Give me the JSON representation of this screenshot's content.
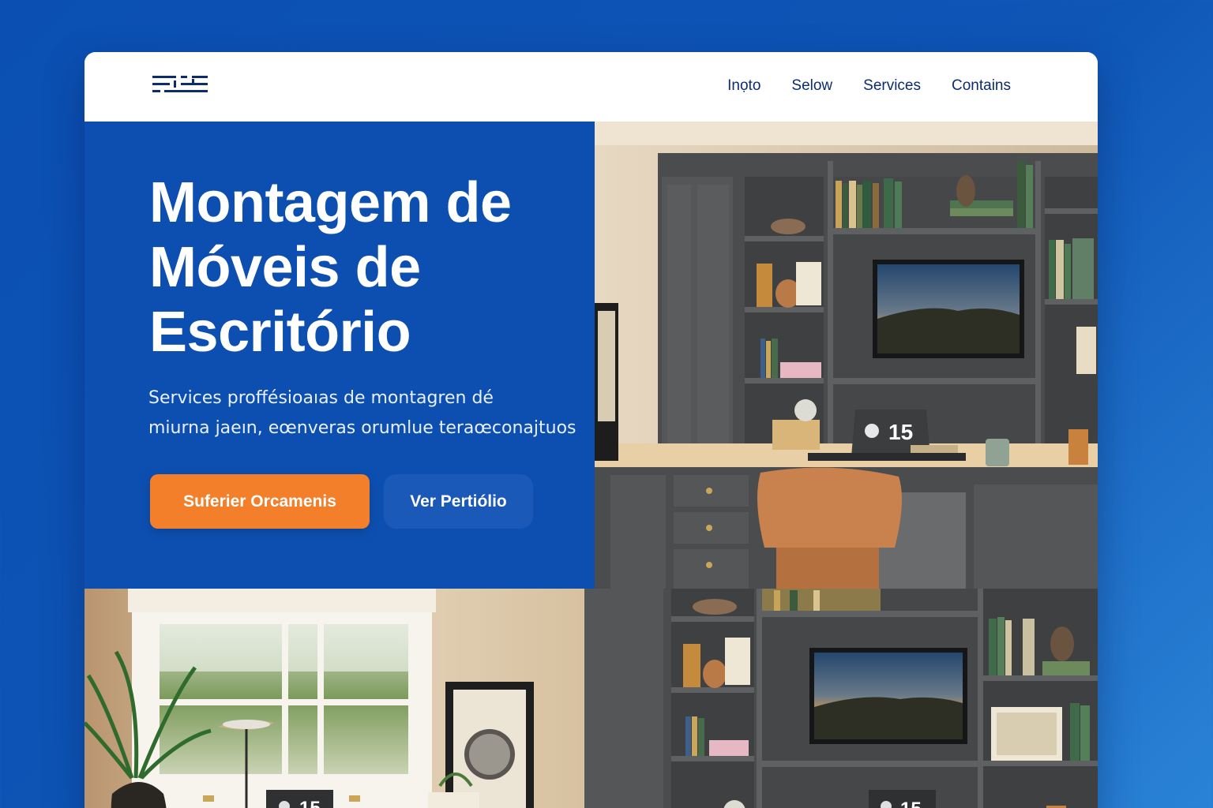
{
  "nav": {
    "logo_icon": "brand-logo-icon",
    "links": [
      "Inọto",
      "Selow",
      "Services",
      "Contains"
    ]
  },
  "hero": {
    "title_lines": [
      "Montagem de",
      "Móveis de",
      "Escritório"
    ],
    "subtitle_lines": [
      "Services proffésioaıas de montagren dé",
      "miurna jaeın, eœnveras orumlue teraœconajtuos"
    ],
    "primary_button": "Suferier Orcamenis",
    "secondary_button": "Ver Pertiólio"
  },
  "photos": {
    "laptop_badge": "15"
  },
  "colors": {
    "background": "#0e55b6",
    "hero_panel": "#0d4fb0",
    "nav_text": "#0b2c6e",
    "primary_button": "#f47f2a",
    "secondary_button": "#1a59b7",
    "cabinet": "#4a4b4c",
    "desk_top": "#e8cfa5",
    "chair": "#c9814e"
  }
}
